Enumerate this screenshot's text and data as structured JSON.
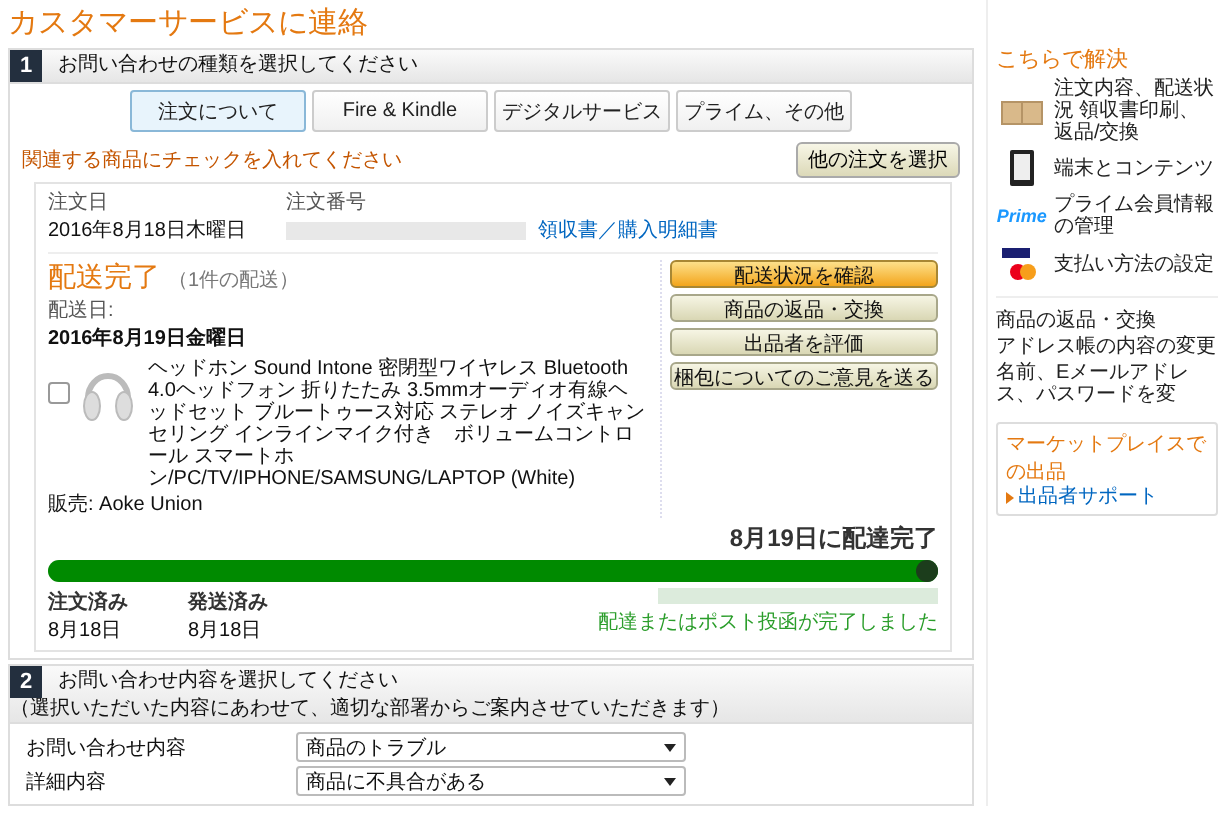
{
  "page_title": "カスタマーサービスに連絡",
  "section1": {
    "number": "1",
    "title": "お問い合わせの種類を選択してください",
    "tabs": [
      {
        "label": "注文について",
        "selected": true
      },
      {
        "label": "Fire & Kindle",
        "selected": false
      },
      {
        "label": "デジタルサービス",
        "selected": false
      },
      {
        "label": "プライム、その他",
        "selected": false
      }
    ],
    "hint": "関連する商品にチェックを入れてください",
    "other_order_button": "他の注文を選択",
    "order": {
      "date_label": "注文日",
      "date": "2016年8月18日木曜日",
      "number_label": "注文番号",
      "receipt_link": "領収書／購入明細書",
      "status": "配送完了",
      "status_note": "（1件の配送）",
      "delivery_label": "配送日:",
      "delivery_date": "2016年8月19日金曜日",
      "item": {
        "checked": false,
        "title": "ヘッドホン Sound Intone 密閉型ワイヤレス Bluetooth 4.0ヘッドフォン 折りたたみ 3.5mmオーディオ有線ヘッドセット ブルートゥース対応 ステレオ ノイズキャンセリング インラインマイク付き　ボリュームコントロール スマートホン/PC/TV/IPHONE/SAMSUNG/LAPTOP (White)",
        "seller": "販売: Aoke Union"
      },
      "actions": [
        {
          "label": "配送状況を確認",
          "kind": "primary"
        },
        {
          "label": "商品の返品・交換",
          "kind": "secondary"
        },
        {
          "label": "出品者を評価",
          "kind": "secondary"
        },
        {
          "label": "梱包についてのご意見を送る",
          "kind": "secondary"
        }
      ],
      "progress_headline": "8月19日に配達完了",
      "progress": {
        "level": 1
      },
      "steps": [
        {
          "label": "注文済み",
          "date": "8月18日"
        },
        {
          "label": "発送済み",
          "date": "8月18日"
        }
      ],
      "progress_note": "配達またはポスト投函が完了しました"
    }
  },
  "section2": {
    "number": "2",
    "title": "お問い合わせ内容を選択してください",
    "note": "（選択いただいた内容にあわせて、適切な部署からご案内させていただきます）",
    "fields": [
      {
        "label": "お問い合わせ内容",
        "value": "商品のトラブル"
      },
      {
        "label": "詳細内容",
        "value": "商品に不具合がある"
      }
    ]
  },
  "sidebar": {
    "title": "こちらで解決",
    "items": [
      {
        "kind": "box",
        "text": "注文内容、配送状況 領収書印刷、返品/交換"
      },
      {
        "kind": "tablet",
        "text": "端末とコンテンツ"
      },
      {
        "kind": "prime",
        "logo": "Prime",
        "text": "プライム会員情報の管理"
      },
      {
        "kind": "card",
        "text": "支払い方法の設定"
      }
    ],
    "links": [
      "商品の返品・交換",
      "アドレス帳の内容の変更",
      "名前、Eメールアドレス、パスワードを変"
    ],
    "marketplace": {
      "title": "マーケットプレイスでの出品",
      "link": "出品者サポート"
    }
  }
}
